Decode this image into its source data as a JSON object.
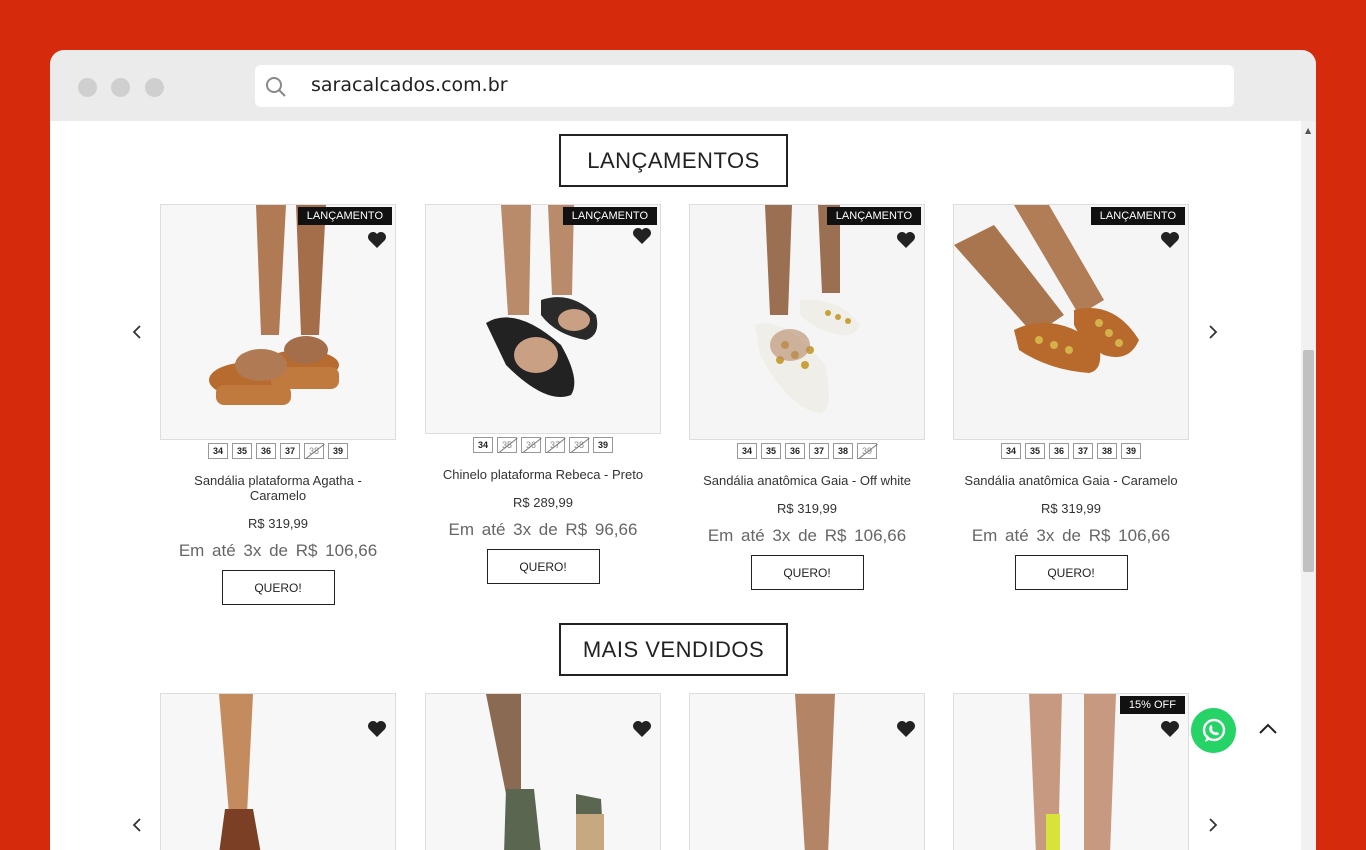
{
  "browser": {
    "url": "saracalcados.com.br"
  },
  "sections": {
    "launches": {
      "title": "LANÇAMENTOS"
    },
    "bestsellers": {
      "title": "MAIS VENDIDOS"
    }
  },
  "nav": {
    "prev": "‹",
    "next": "›"
  },
  "launches": [
    {
      "badge": "LANÇAMENTO",
      "name": "Sandália plataforma Agatha - Caramelo",
      "price": "R$ 319,99",
      "installment": "Em até 3x de R$ 106,66",
      "button": "QUERO!",
      "sizes": [
        "34",
        "35",
        "36",
        "37",
        "38",
        "39"
      ],
      "unavailable": [
        "38"
      ]
    },
    {
      "badge": "LANÇAMENTO",
      "name": "Chinelo plataforma Rebeca - Preto",
      "price": "R$ 289,99",
      "installment": "Em até 3x de R$ 96,66",
      "button": "QUERO!",
      "sizes": [
        "34",
        "35",
        "36",
        "37",
        "38",
        "39"
      ],
      "unavailable": [
        "35",
        "36",
        "37",
        "38"
      ]
    },
    {
      "badge": "LANÇAMENTO",
      "name": "Sandália anatômica Gaia - Off white",
      "price": "R$ 319,99",
      "installment": "Em até 3x de R$ 106,66",
      "button": "QUERO!",
      "sizes": [
        "34",
        "35",
        "36",
        "37",
        "38",
        "39"
      ],
      "unavailable": [
        "39"
      ]
    },
    {
      "badge": "LANÇAMENTO",
      "name": "Sandália anatômica Gaia - Caramelo",
      "price": "R$ 319,99",
      "installment": "Em até 3x de R$ 106,66",
      "button": "QUERO!",
      "sizes": [
        "34",
        "35",
        "36",
        "37",
        "38",
        "39"
      ],
      "unavailable": []
    }
  ],
  "bestsellers": [
    {
      "badge": ""
    },
    {
      "badge": ""
    },
    {
      "badge": ""
    },
    {
      "badge": "15% OFF"
    }
  ],
  "colors": {
    "frame_background": "#d52b0c",
    "badge": "#111111",
    "whatsapp": "#25d366"
  }
}
